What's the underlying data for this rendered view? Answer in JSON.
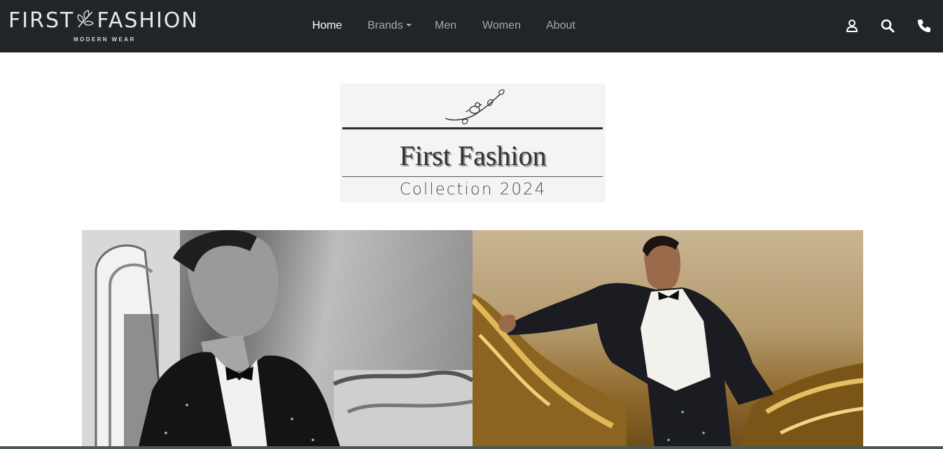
{
  "navbar": {
    "brand": {
      "name_left": "FIRST",
      "name_right": "FASHION",
      "tagline": "MODERN WEAR",
      "icon": "leaf-icon"
    },
    "links": [
      {
        "label": "Home",
        "active": true
      },
      {
        "label": "Brands",
        "dropdown": true
      },
      {
        "label": "Men"
      },
      {
        "label": "Women"
      },
      {
        "label": "About"
      }
    ],
    "icons": [
      "user-icon",
      "search-icon",
      "phone-icon"
    ]
  },
  "collection": {
    "title": "First Fashion",
    "subtitle": "Collection 2024",
    "art": "bird-on-branch-icon"
  },
  "hero": {
    "images": [
      "man-in-tuxedo-black-and-white-photo",
      "man-in-tuxedo-color-photo"
    ]
  },
  "colors": {
    "navbar_bg": "#212428",
    "nav_active": "#ffffff",
    "nav_inactive": "#a6a8ab",
    "page_bg": "#ffffff"
  }
}
